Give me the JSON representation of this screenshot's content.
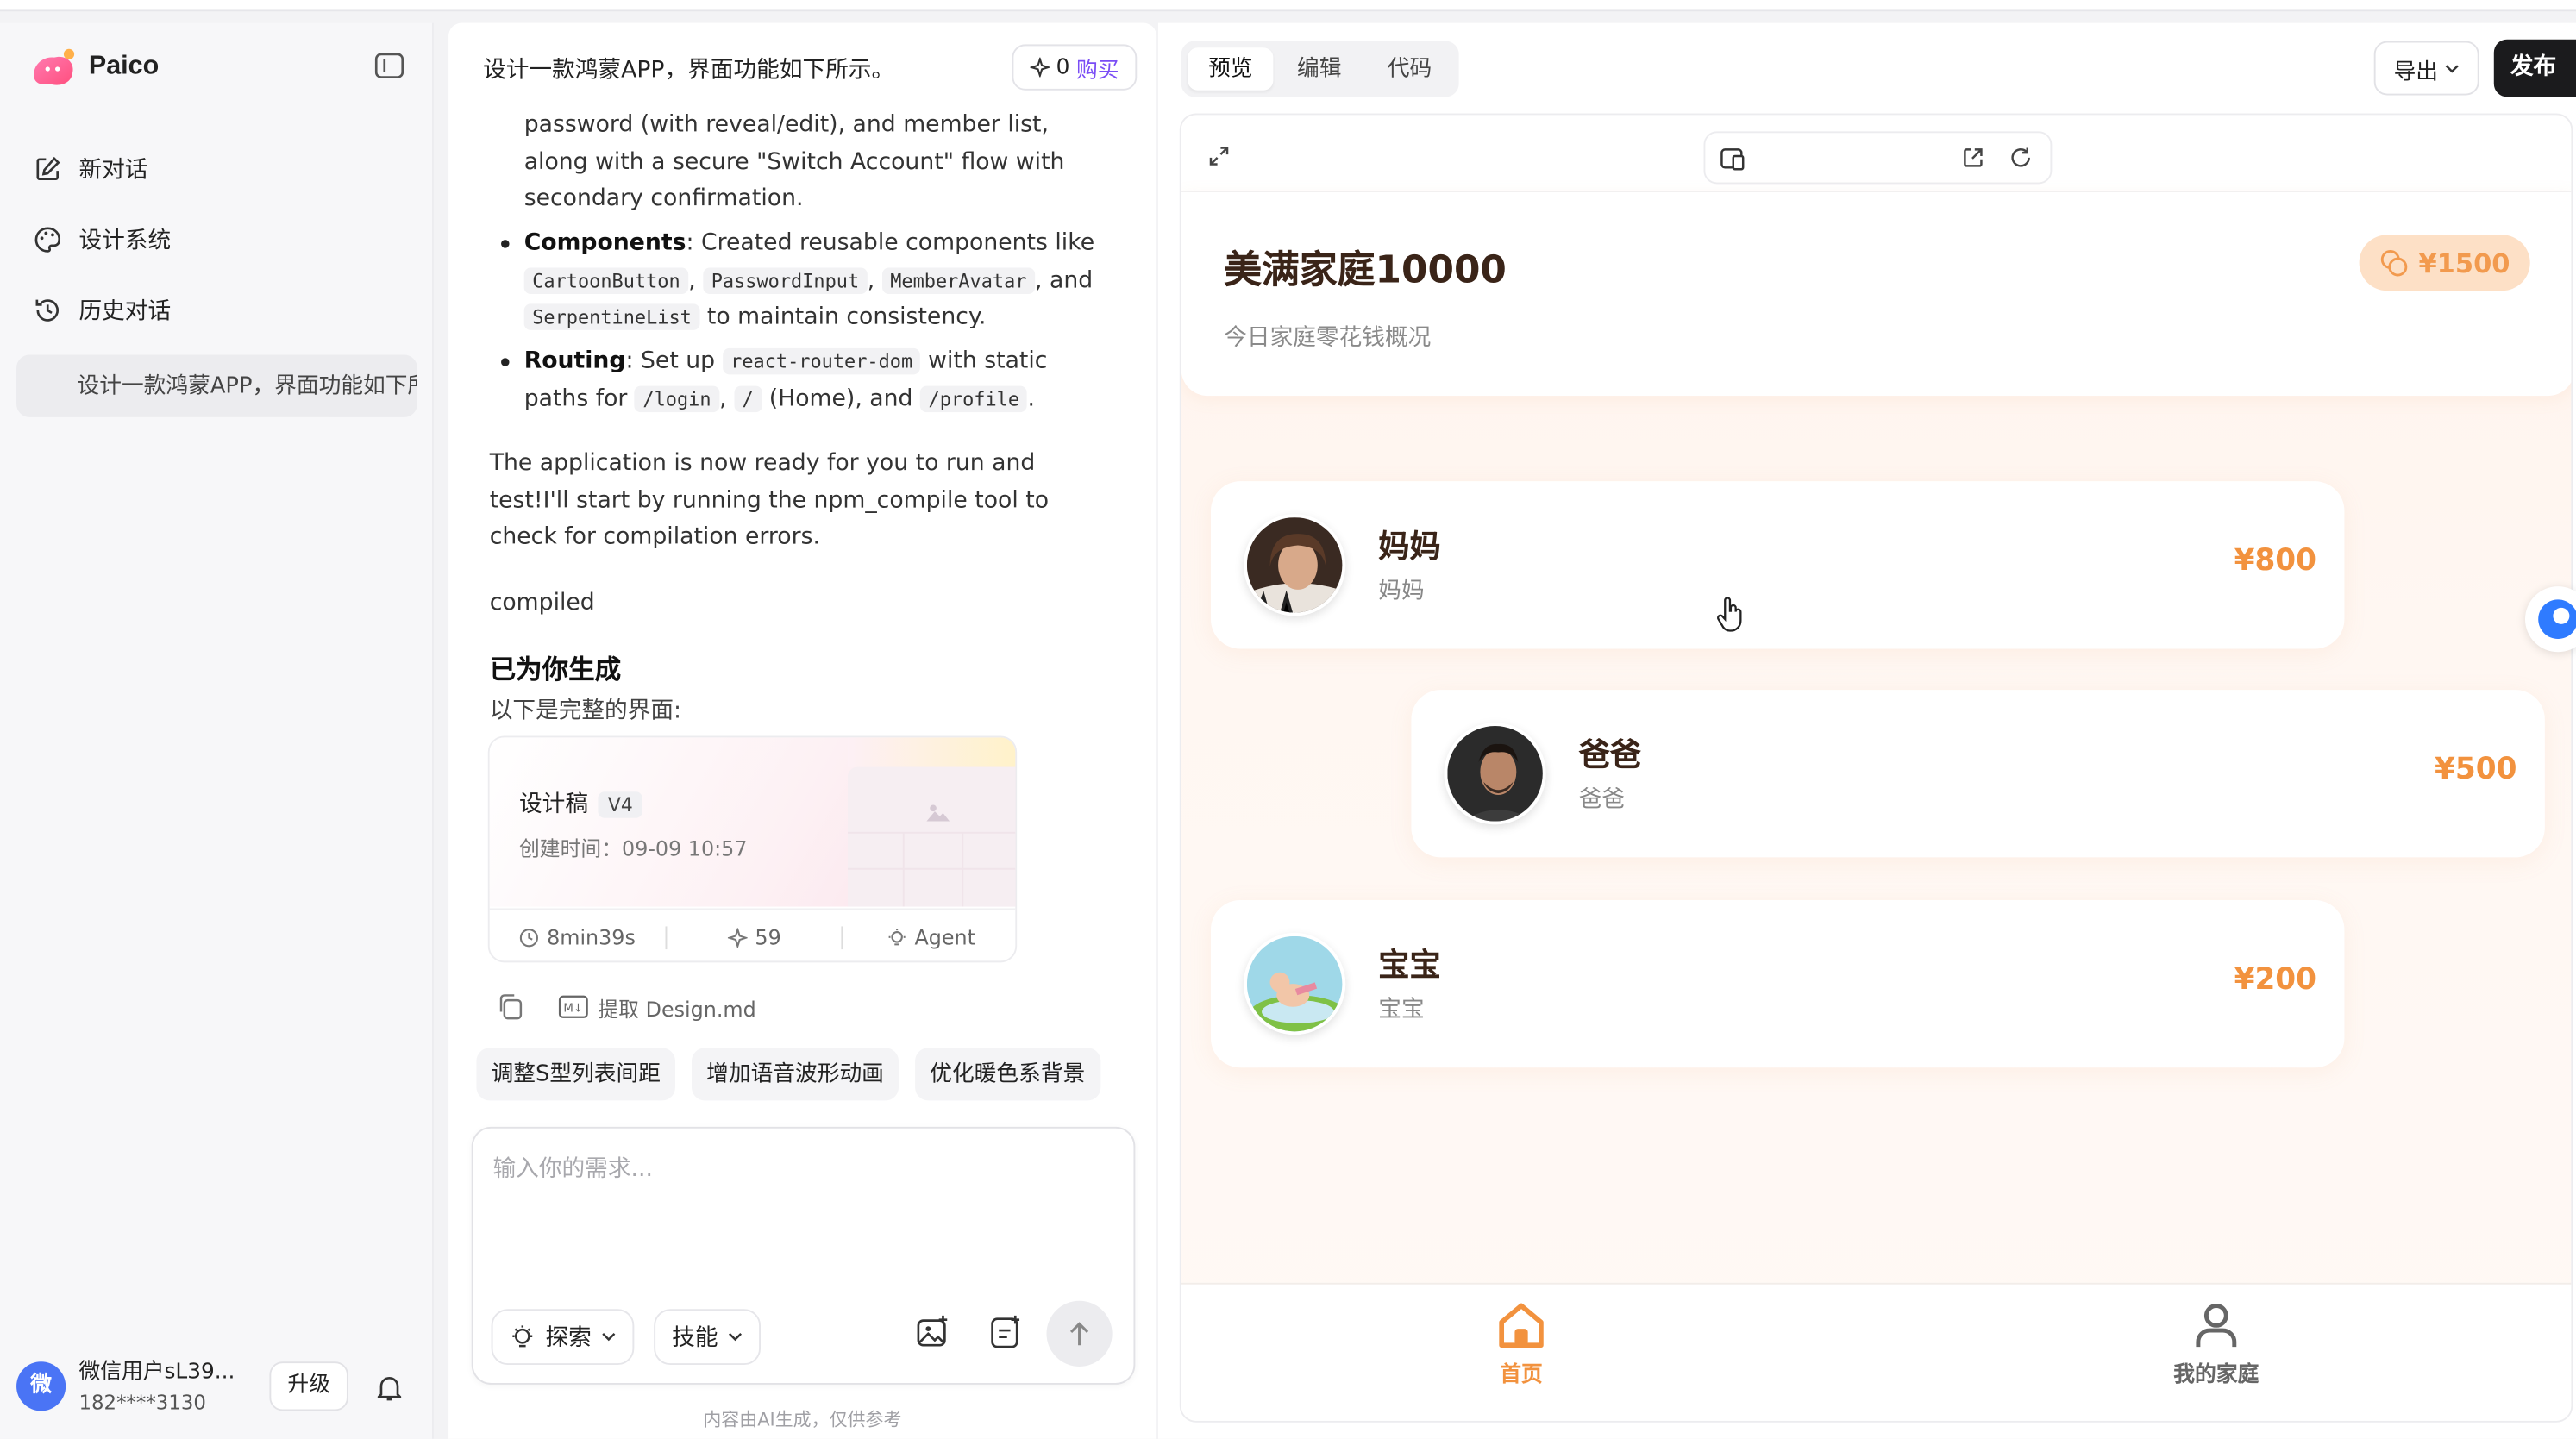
{
  "app": {
    "name": "Paico"
  },
  "sidebar": {
    "new_chat": "新对话",
    "design_system": "设计系统",
    "history": "历史对话",
    "history_items": [
      "设计一款鸿蒙APP，界面功能如下所示。"
    ]
  },
  "user": {
    "avatar_char": "微",
    "name": "微信用户sL39...",
    "phone": "182****3130",
    "upgrade": "升级"
  },
  "chat": {
    "title": "设计一款鸿蒙APP，界面功能如下所示。",
    "credits": "0",
    "buy": "购买",
    "para1": "password (with reveal/edit), and member list, along with a secure \"Switch Account\" flow with secondary confirmation.",
    "b1_label": "Components",
    "b1_pre": ": Created reusable components like ",
    "b1_codes": [
      "CartoonButton",
      "PasswordInput",
      "MemberAvatar",
      "SerpentineList"
    ],
    "b1_and": ", and",
    "b1_post": " to maintain consistency.",
    "b2_label": "Routing",
    "b2_pre": ": Set up ",
    "b2_code": "react-router-dom",
    "b2_mid": " with static paths for ",
    "b2_paths": [
      "/login",
      "/",
      "/profile"
    ],
    "b2_home": " (Home), and ",
    "para2": "The application is now ready for you to run and test!I'll start by running the npm_compile tool to check for compilation errors.",
    "compiled": "compiled",
    "generated_heading": "已为你生成",
    "generated_sub": "以下是完整的界面:",
    "card": {
      "title": "设计稿",
      "version": "V4",
      "created": "创建时间：09-09 10:57",
      "duration": "8min39s",
      "points": "59",
      "mode": "Agent"
    },
    "extract": "提取 Design.md",
    "suggestions": [
      "调整S型列表间距",
      "增加语音波形动画",
      "优化暖色系背景"
    ],
    "input_placeholder": "输入你的需求...",
    "explore": "探索",
    "skills": "技能",
    "disclaimer": "内容由AI生成，仅供参考"
  },
  "preview": {
    "tabs": [
      "预览",
      "编辑",
      "代码"
    ],
    "active_tab": "预览",
    "export": "导出",
    "publish": "发布",
    "app_screen": {
      "title": "美满家庭10000",
      "subtitle": "今日家庭零花钱概况",
      "total": "¥1500",
      "members": [
        {
          "name": "妈妈",
          "role": "妈妈",
          "amount": "¥800"
        },
        {
          "name": "爸爸",
          "role": "爸爸",
          "amount": "¥500"
        },
        {
          "name": "宝宝",
          "role": "宝宝",
          "amount": "¥200"
        }
      ],
      "nav": [
        {
          "label": "首页",
          "active": true
        },
        {
          "label": "我的家庭",
          "active": false
        }
      ]
    },
    "accent_color": "#f2923e"
  }
}
